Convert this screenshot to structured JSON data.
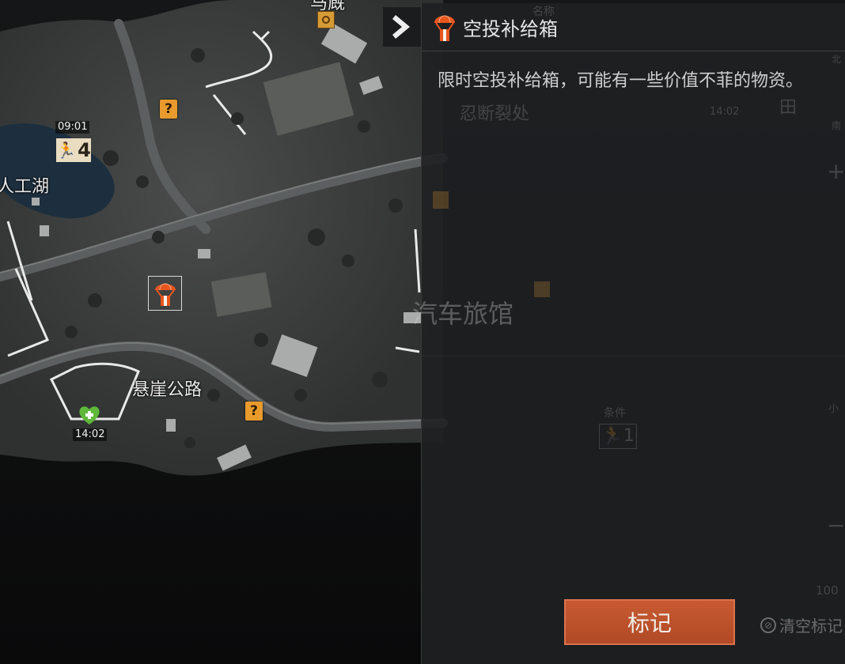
{
  "map": {
    "labels": {
      "lake": "人工湖",
      "cliff_road": "悬崖公路",
      "top_partial": "马厩"
    },
    "timers": {
      "lake_exit": "09:01",
      "medical": "14:02"
    },
    "exit_number": "4"
  },
  "panel": {
    "title": "空投补给箱",
    "description": "限时空投补给箱，可能有一些价值不菲的物资。",
    "mark_button": "标记",
    "clear_marks": "清空标记"
  },
  "background_map": {
    "labels": {
      "break_point": "忍断裂处",
      "motel": "汽车旅馆",
      "condition": "条件",
      "north": "北",
      "south": "南",
      "field": "田",
      "time": "14:02",
      "scale": "100",
      "small": "小",
      "name": "名称"
    },
    "exit_number": "1"
  },
  "colors": {
    "accent": "#c4552f",
    "airdrop_icon": "#e8561e",
    "question_mark": "#e89a2c",
    "medical": "#5fb83a"
  }
}
